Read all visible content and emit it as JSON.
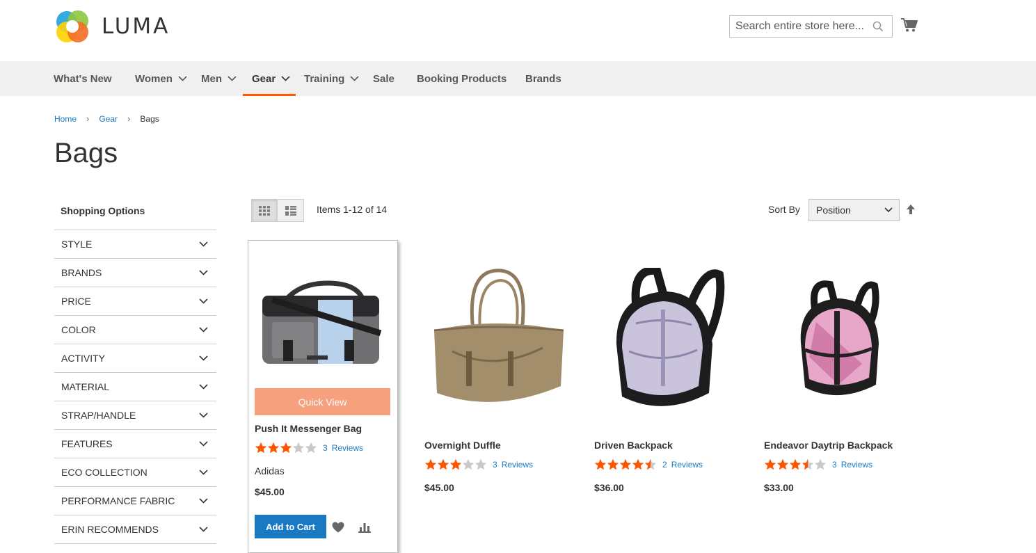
{
  "brand": {
    "name": "LUMA"
  },
  "search": {
    "placeholder": "Search entire store here..."
  },
  "nav": {
    "items": [
      {
        "label": "What's New"
      },
      {
        "label": "Women"
      },
      {
        "label": "Men"
      },
      {
        "label": "Gear"
      },
      {
        "label": "Training"
      },
      {
        "label": "Sale"
      },
      {
        "label": "Booking Products"
      },
      {
        "label": "Brands"
      }
    ]
  },
  "breadcrumb": {
    "home": "Home",
    "gear": "Gear",
    "current": "Bags"
  },
  "page": {
    "title": "Bags"
  },
  "sidebar": {
    "title": "Shopping Options",
    "filters": [
      "STYLE",
      "BRANDS",
      "PRICE",
      "COLOR",
      "ACTIVITY",
      "MATERIAL",
      "STRAP/HANDLE",
      "FEATURES",
      "ECO COLLECTION",
      "PERFORMANCE FABRIC",
      "ERIN RECOMMENDS"
    ]
  },
  "toolbar": {
    "items_count": "Items 1-12 of 14",
    "sort_label": "Sort By",
    "sort_value": "Position"
  },
  "products": [
    {
      "name": "Push It Messenger Bag",
      "rating_pct": 60,
      "review_count": "3",
      "reviews_label": "Reviews",
      "brand": "Adidas",
      "price": "$45.00",
      "quick_view": "Quick View",
      "add_to_cart": "Add to Cart"
    },
    {
      "name": "Overnight Duffle",
      "rating_pct": 60,
      "review_count": "3",
      "reviews_label": "Reviews",
      "price": "$45.00"
    },
    {
      "name": "Driven Backpack",
      "rating_pct": 90,
      "review_count": "2",
      "reviews_label": "Reviews",
      "price": "$36.00"
    },
    {
      "name": "Endeavor Daytrip Backpack",
      "rating_pct": 70,
      "review_count": "3",
      "reviews_label": "Reviews",
      "price": "$33.00"
    }
  ],
  "colors": {
    "accent": "#ff5501",
    "link": "#1979c3",
    "star": "#ff5501",
    "quick_view": "#f6a07d",
    "nav_bg": "#f0f0f0"
  },
  "icons": [
    "search-icon",
    "cart-icon",
    "chevron-down-icon",
    "grid-icon",
    "list-icon",
    "sort-arrow-icon",
    "heart-icon",
    "compare-icon",
    "star-icon"
  ]
}
